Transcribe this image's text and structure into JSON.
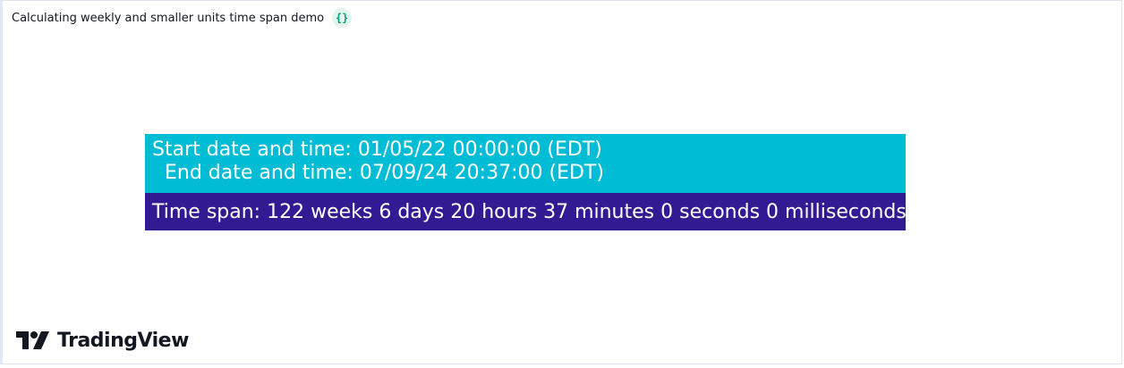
{
  "header": {
    "script_title": "Calculating weekly and smaller units time span demo",
    "source_icon": "{}"
  },
  "table": {
    "start_line": "Start date and time: 01/05/22 00:00:00 (EDT)",
    "end_line": "  End date and time: 07/09/24 20:37:00 (EDT)",
    "span_line": "Time span: 122 weeks 6 days 20 hours 37 minutes 0 seconds 0 milliseconds"
  },
  "brand": {
    "name": "TradingView",
    "logo_icon": "tradingview-logo-icon"
  },
  "colors": {
    "dates_bg": "#00bcd4",
    "span_bg": "#311b92",
    "text": "#ffffff",
    "source_icon_color": "#089981"
  }
}
